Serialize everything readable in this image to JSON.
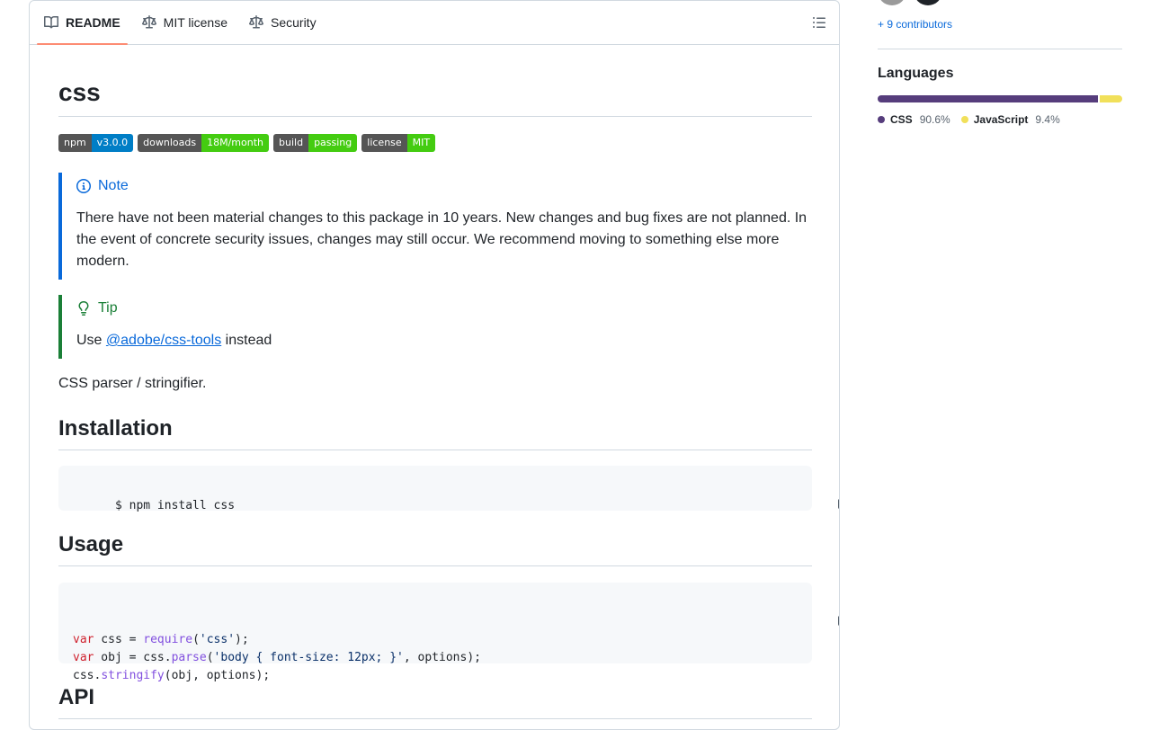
{
  "tabs": [
    {
      "label": "README",
      "icon": "book-icon",
      "active": true
    },
    {
      "label": "MIT license",
      "icon": "law-icon",
      "active": false
    },
    {
      "label": "Security",
      "icon": "law-icon",
      "active": false
    }
  ],
  "readme": {
    "title": "css",
    "badges": [
      {
        "left": "npm",
        "right": "v3.0.0",
        "color": "#007ec6"
      },
      {
        "left": "downloads",
        "right": "18M/month",
        "color": "#4c1"
      },
      {
        "left": "build",
        "right": "passing",
        "color": "#4c1"
      },
      {
        "left": "license",
        "right": "MIT",
        "color": "#4c1"
      }
    ],
    "note": {
      "title": "Note",
      "text": "There have not been material changes to this package in 10 years. New changes and bug fixes are not planned. In the event of concrete security issues, changes may still occur. We recommend moving to something else more modern."
    },
    "tip": {
      "title": "Tip",
      "prefix": "Use ",
      "link": "@adobe/css-tools",
      "suffix": " instead"
    },
    "description": "CSS parser / stringifier.",
    "installation": {
      "heading": "Installation",
      "code": "$ npm install css"
    },
    "usage": {
      "heading": "Usage",
      "code_lines": [
        "var css = require('css');",
        "var obj = css.parse('body { font-size: 12px; }', options);",
        "css.stringify(obj, options);"
      ]
    },
    "api": {
      "heading": "API"
    }
  },
  "sidebar": {
    "contributors_link": "+ 9 contributors",
    "languages_title": "Languages",
    "languages": [
      {
        "name": "CSS",
        "percent": "90.6%",
        "value": 90.6,
        "color": "#563d7c"
      },
      {
        "name": "JavaScript",
        "percent": "9.4%",
        "value": 9.4,
        "color": "#f1e05a"
      }
    ]
  }
}
